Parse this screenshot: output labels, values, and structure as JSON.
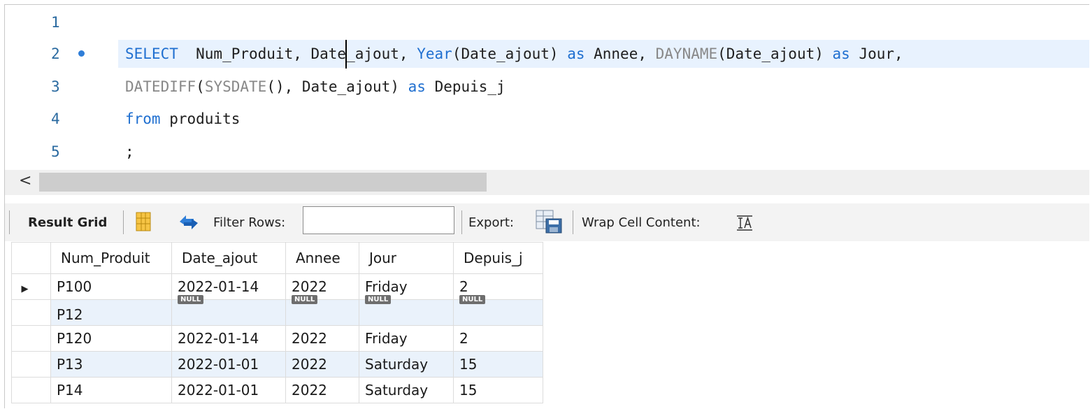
{
  "editor": {
    "lines": [
      {
        "num": "1"
      },
      {
        "num": "2"
      },
      {
        "num": "3"
      },
      {
        "num": "4"
      },
      {
        "num": "5"
      }
    ],
    "line2": {
      "t1": "SELECT",
      "t2": "  Num_Produit, Date_ajout, ",
      "t3": "Year",
      "t4": "(Date_ajout) ",
      "t5": "as",
      "t6": " Annee, ",
      "t7": "DAYNAME",
      "t8": "(Date_ajout) ",
      "t9": "as",
      "t10": " Jour,"
    },
    "line3": {
      "t1": "DATEDIFF",
      "t2": "(",
      "t3": "SYSDATE",
      "t4": "(), Date_ajout) ",
      "t5": "as",
      "t6": " Depuis_j"
    },
    "line4": {
      "t1": "from",
      "t2": " produits"
    },
    "line5": {
      "t1": ";"
    }
  },
  "scrollbar": {
    "left_arrow": "<"
  },
  "toolbar": {
    "result_grid_label": "Result Grid",
    "filter_rows_label": "Filter Rows:",
    "filter_rows_value": "",
    "export_label": "Export:",
    "wrap_label": "Wrap Cell Content:"
  },
  "grid": {
    "columns": [
      "Num_Produit",
      "Date_ajout",
      "Annee",
      "Jour",
      "Depuis_j"
    ],
    "rows": [
      {
        "selected": "▶",
        "num": "P100",
        "date": "2022-01-14",
        "annee": "2022",
        "jour": "Friday",
        "depuis": "2"
      },
      {
        "selected": "",
        "num": "P12",
        "date": "NULL",
        "annee": "NULL",
        "jour": "NULL",
        "depuis": "NULL"
      },
      {
        "selected": "",
        "num": "P120",
        "date": "2022-01-14",
        "annee": "2022",
        "jour": "Friday",
        "depuis": "2"
      },
      {
        "selected": "",
        "num": "P13",
        "date": "2022-01-01",
        "annee": "2022",
        "jour": "Saturday",
        "depuis": "15"
      },
      {
        "selected": "",
        "num": "P14",
        "date": "2022-01-01",
        "annee": "2022",
        "jour": "Saturday",
        "depuis": "15"
      }
    ]
  },
  "colors": {
    "keyword": "#1f6fd0",
    "function": "#888888",
    "line_number": "#2a6aa0",
    "active_line": "#e8f2fe",
    "alt_row": "#eaf2fb"
  }
}
